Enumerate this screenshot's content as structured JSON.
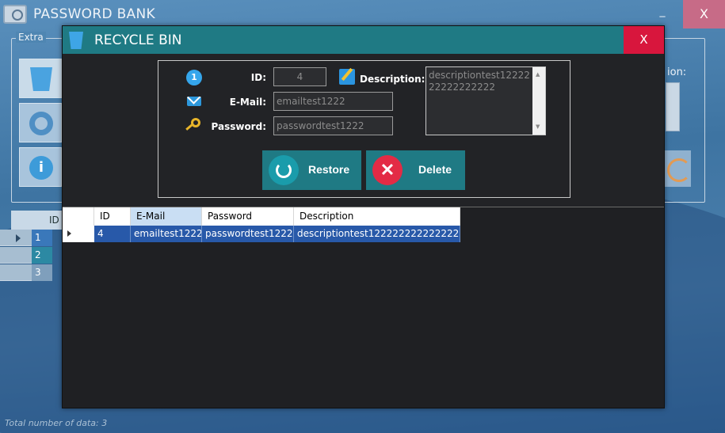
{
  "main": {
    "title": "PASSWORD BANK",
    "minimize": "_",
    "close": "X",
    "extra_label": "Extra",
    "right_partial_label": "ion:",
    "grid": {
      "header": "ID",
      "rows": [
        "1",
        "2",
        "3"
      ]
    },
    "status": "Total number of data: 3"
  },
  "dialog": {
    "title": "RECYCLE BIN",
    "close": "X",
    "form": {
      "id_label": "ID:",
      "id_value": "4",
      "email_label": "E-Mail:",
      "email_value": "emailtest1222",
      "password_label": "Password:",
      "password_value": "passwordtest1222",
      "description_label": "Description:",
      "description_value": "descriptiontest1222222222222222"
    },
    "buttons": {
      "restore": "Restore",
      "delete": "Delete"
    },
    "table": {
      "columns": [
        "ID",
        "E-Mail",
        "Password",
        "Description"
      ],
      "rows": [
        [
          "4",
          "emailtest1222",
          "passwordtest1222",
          "descriptiontest1222222222222222"
        ]
      ]
    }
  },
  "icons": {
    "app": "vault-icon",
    "dialog": "recycle-bin-icon",
    "id": "number-one-icon",
    "email": "envelope-icon",
    "password": "key-icon",
    "description": "edit-pencil-icon",
    "restore": "refresh-icon",
    "delete": "x-circle-icon"
  },
  "colors": {
    "dialog_titlebar": "#1f7a84",
    "dialog_close": "#d8163d",
    "selected_row": "#2859a9",
    "action_buttons": "#1f7a84",
    "delete_icon": "#e32b45"
  }
}
